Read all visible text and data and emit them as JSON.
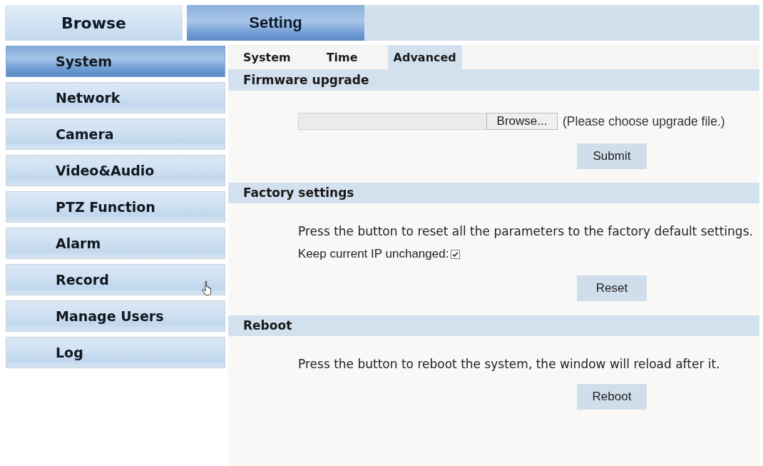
{
  "top_tabs": [
    {
      "label": "Browse",
      "selected": false
    },
    {
      "label": "Setting",
      "selected": true
    }
  ],
  "sidebar": {
    "items": [
      {
        "label": "System",
        "selected": true,
        "hovered": false
      },
      {
        "label": "Network",
        "selected": false,
        "hovered": false
      },
      {
        "label": "Camera",
        "selected": false,
        "hovered": false
      },
      {
        "label": "Video&Audio",
        "selected": false,
        "hovered": false
      },
      {
        "label": "PTZ Function",
        "selected": false,
        "hovered": false
      },
      {
        "label": "Alarm",
        "selected": false,
        "hovered": false
      },
      {
        "label": "Record",
        "selected": false,
        "hovered": true
      },
      {
        "label": "Manage Users",
        "selected": false,
        "hovered": false
      },
      {
        "label": "Log",
        "selected": false,
        "hovered": false
      }
    ]
  },
  "sub_tabs": [
    {
      "label": "System",
      "selected": false
    },
    {
      "label": "Time",
      "selected": false
    },
    {
      "label": "Advanced",
      "selected": true
    }
  ],
  "sections": [
    {
      "kind": "upload",
      "title": "Firmware upgrade",
      "file_button": "Browse...",
      "hint": "(Please choose upgrade file.)",
      "button": "Submit"
    },
    {
      "kind": "action",
      "title": "Factory settings",
      "text": "Press the button to reset all the parameters to the factory default settings.",
      "checkbox": {
        "label": "Keep current IP unchanged:",
        "checked": true
      },
      "button": "Reset"
    },
    {
      "kind": "action",
      "title": "Reboot",
      "text": "Press the button to reboot the system, the window will reload after it.",
      "button": "Reboot"
    }
  ]
}
